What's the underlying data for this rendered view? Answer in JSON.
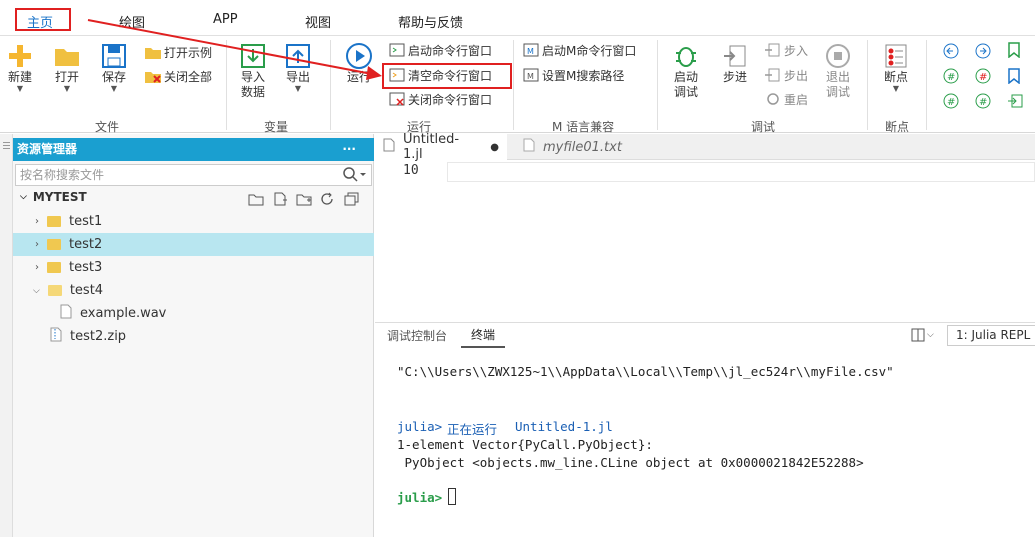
{
  "menu": {
    "tabs": [
      "主页",
      "绘图",
      "APP",
      "视图",
      "帮助与反馈"
    ]
  },
  "ribbon": {
    "file": {
      "new": "新建",
      "open": "打开",
      "save": "保存",
      "open_example": "打开示例",
      "close_all": "关闭全部",
      "group": "文件"
    },
    "variable": {
      "import_data_1": "导入",
      "import_data_2": "数据",
      "export": "导出",
      "group": "变量"
    },
    "run": {
      "run": "运行",
      "start_cmd": "启动命令行窗口",
      "clear_cmd": "清空命令行窗口",
      "close_cmd": "关闭命令行窗口",
      "group": "运行"
    },
    "m_compat": {
      "start_m": "启动M命令行窗口",
      "set_m_path": "设置M搜索路径",
      "group": "M 语言兼容"
    },
    "debug": {
      "start_debug_1": "启动",
      "start_debug_2": "调试",
      "step": "步进",
      "step_in": "步入",
      "step_out": "步出",
      "restart": "重启",
      "exit_debug_1": "退出",
      "exit_debug_2": "调试",
      "group": "调试"
    },
    "breakpoint": {
      "breakpoint": "断点",
      "group": "断点"
    }
  },
  "explorer": {
    "title": "资源管理器",
    "more": "···",
    "search_placeholder": "按名称搜索文件",
    "root": "MYTEST",
    "items": [
      {
        "label": "test1"
      },
      {
        "label": "test2"
      },
      {
        "label": "test3"
      },
      {
        "label": "test4"
      },
      {
        "label": "example.wav"
      },
      {
        "label": "test2.zip"
      }
    ]
  },
  "editor": {
    "tabs": [
      {
        "label": "Untitled-1.jl"
      },
      {
        "label": "myfile01.txt"
      }
    ],
    "line_number": "10"
  },
  "bottom": {
    "tabs": [
      "调试控制台",
      "终端"
    ],
    "repl_select": "1: Julia REPL",
    "lines": [
      "\"C:\\\\Users\\\\ZWX125~1\\\\AppData\\\\Local\\\\Temp\\\\jl_ec524r\\\\myFile.csv\"",
      "正在运行",
      "Untitled-1.jl",
      "1-element Vector{PyCall.PyObject}:",
      " PyObject <objects.mw_line.CLine object at 0x0000021842E52288>"
    ],
    "prompt": "julia>"
  },
  "colors": {
    "accent": "#1a9fd0",
    "highlight": "#e02020",
    "selection": "#b8e6f0"
  }
}
